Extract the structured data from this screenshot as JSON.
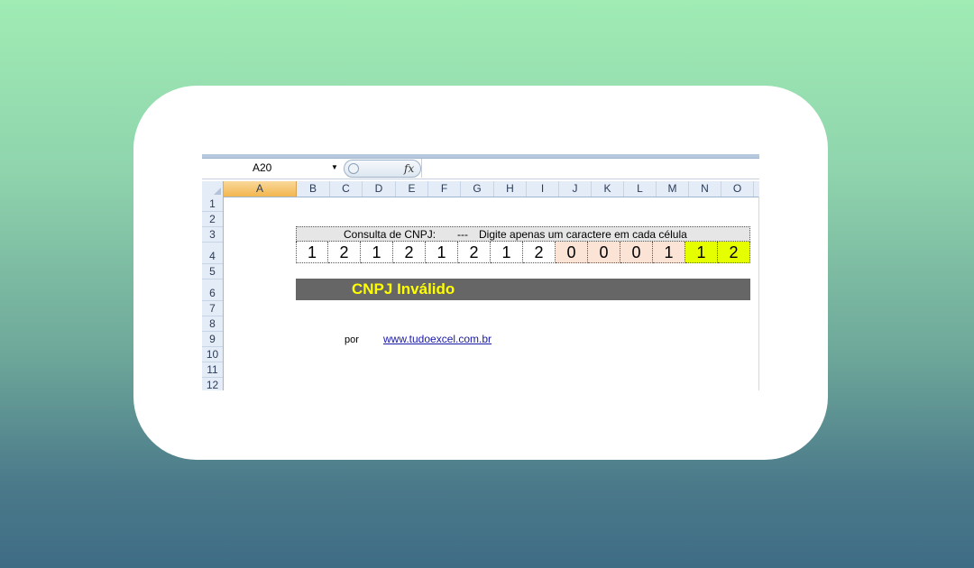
{
  "namebox": {
    "value": "A20"
  },
  "formula_bar": {
    "fx_label": "fx"
  },
  "columns": [
    "A",
    "B",
    "C",
    "D",
    "E",
    "F",
    "G",
    "H",
    "I",
    "J",
    "K",
    "L",
    "M",
    "N",
    "O"
  ],
  "rows": [
    "1",
    "2",
    "3",
    "4",
    "5",
    "6",
    "7",
    "8",
    "9",
    "10",
    "11",
    "12"
  ],
  "cnpj": {
    "header_label": "Consulta de CNPJ:",
    "header_sep": "---",
    "header_hint": "Digite apenas um caractere em cada célula",
    "digits": [
      "1",
      "2",
      "1",
      "2",
      "1",
      "2",
      "1",
      "2",
      "0",
      "0",
      "0",
      "1",
      "1",
      "2"
    ],
    "digit_colors": [
      "#ffffff",
      "#ffffff",
      "#ffffff",
      "#ffffff",
      "#ffffff",
      "#ffffff",
      "#ffffff",
      "#ffffff",
      "#fbe4d5",
      "#fbe4d5",
      "#fbe4d5",
      "#fbe4d5",
      "#e6ff00",
      "#e6ff00"
    ]
  },
  "result": {
    "status": "CNPJ Inválido",
    "background": "#666666",
    "text_color": "#ffff00"
  },
  "credit": {
    "by": "por",
    "link": "www.tudoexcel.com.br"
  }
}
